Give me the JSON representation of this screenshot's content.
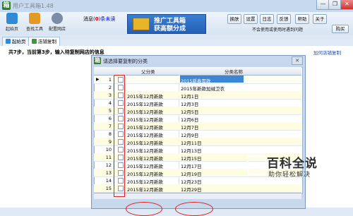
{
  "window": {
    "icon": "app-icon",
    "title": "用户工具箱1.48",
    "minimize_label": "—",
    "restore_label": "❐",
    "close_label": "✕"
  },
  "toolbar": {
    "items": [
      {
        "label": "起始页",
        "icon": "home-icon",
        "color": "#2d8bd8"
      },
      {
        "label": "查找工具",
        "icon": "search-tool-icon",
        "color": "#e29a25"
      },
      {
        "label": "配置网店",
        "icon": "gear-icon",
        "color": "#7a8ca6"
      }
    ],
    "message": {
      "prefix": "消息(",
      "count": "0",
      "suffix": ")条未读"
    },
    "banner": {
      "line1": "推广工具箱",
      "line2": "获高额分成"
    },
    "buttons": [
      "换肤",
      "设置",
      "日志",
      "反馈",
      "帮助",
      "关于"
    ],
    "warning_label": "不会使用或使用时遇到问题",
    "buy_label": "购买"
  },
  "tabs": [
    {
      "label": "起始页",
      "icon": "home-icon",
      "active": false
    },
    {
      "label": "店铺复制",
      "icon": "copy-icon",
      "active": true
    }
  ],
  "step_text": "共7步，当前第3步，输入待复制网店的信息",
  "add_site_link": "加何店铺复制",
  "dialog": {
    "title": "请选择要复制的分类",
    "close_label": "✕",
    "columns": [
      "父分类",
      "分类名称"
    ],
    "rows": [
      {
        "num": "1",
        "parent": "",
        "name": "2015新春零款",
        "current": true
      },
      {
        "num": "2",
        "parent": "",
        "name": "2015年新款加绒卫衣"
      },
      {
        "num": "3",
        "parent": "2015年12月新款",
        "name": "12月1日"
      },
      {
        "num": "4",
        "parent": "2015年12月新款",
        "name": "12月3日"
      },
      {
        "num": "5",
        "parent": "2015年12月新款",
        "name": "12月5日"
      },
      {
        "num": "6",
        "parent": "2015年12月新款",
        "name": "12月6日"
      },
      {
        "num": "7",
        "parent": "2015年12月新款",
        "name": "12月7日"
      },
      {
        "num": "8",
        "parent": "2015年12月新款",
        "name": "12月9日"
      },
      {
        "num": "9",
        "parent": "2015年12月新款",
        "name": "12月11日"
      },
      {
        "num": "10",
        "parent": "2015年12月新款",
        "name": "12月13日"
      },
      {
        "num": "11",
        "parent": "2015年12月新款",
        "name": "12月15日"
      },
      {
        "num": "12",
        "parent": "2015年12月新款",
        "name": "12月17日"
      },
      {
        "num": "13",
        "parent": "2015年12月新款",
        "name": "12月19日"
      },
      {
        "num": "14",
        "parent": "2015年12月新款",
        "name": "12月23日"
      },
      {
        "num": "15",
        "parent": "2015年12月新款",
        "name": "12月29日"
      }
    ]
  },
  "watermark": {
    "line1": "百科全说",
    "line2": "助你轻松解决"
  },
  "colors": {
    "annotation": "#e02020",
    "selection": "#3f85d6",
    "row_alt": "#fefde2"
  }
}
